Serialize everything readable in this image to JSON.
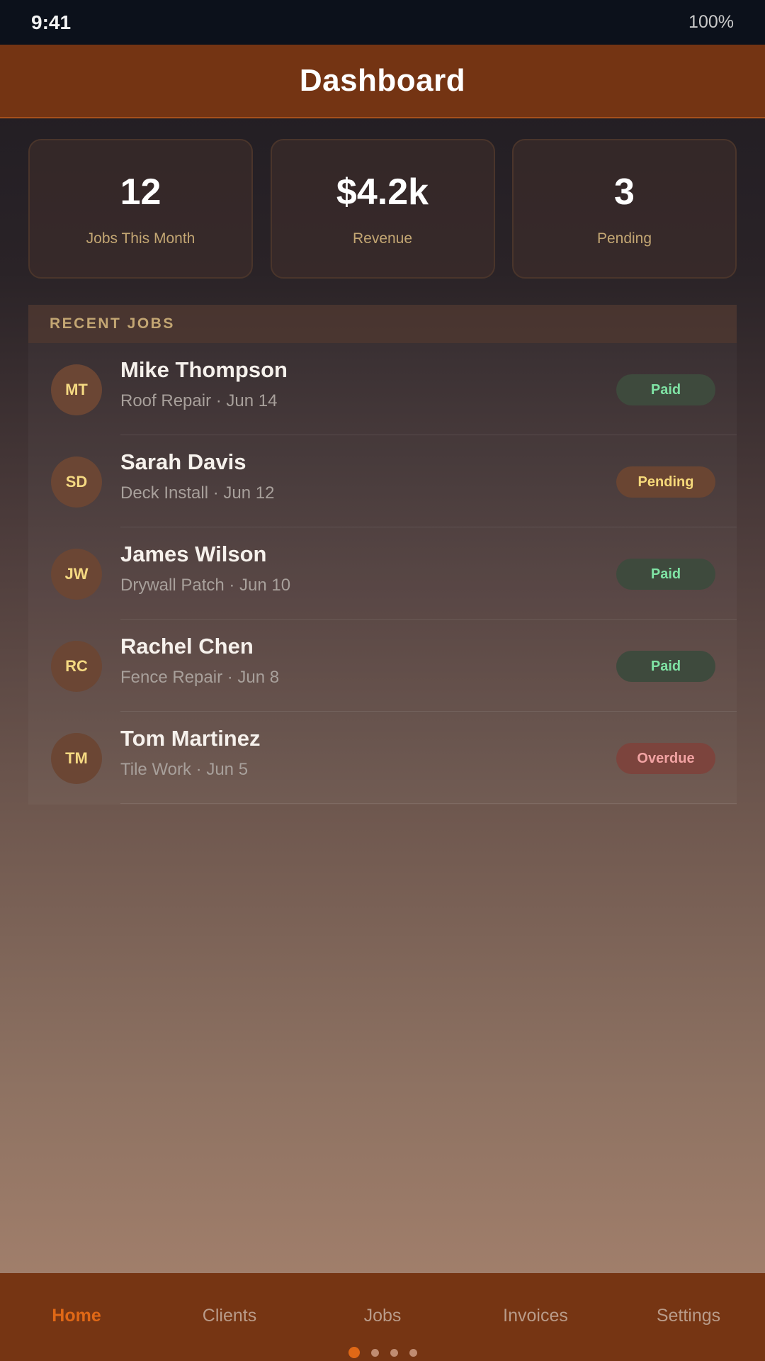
{
  "status": {
    "time": "9:41",
    "battery": "100%"
  },
  "header": {
    "title": "Dashboard"
  },
  "stats": [
    {
      "value": "12",
      "label": "Jobs This Month"
    },
    {
      "value": "$4.2k",
      "label": "Revenue"
    },
    {
      "value": "3",
      "label": "Pending"
    }
  ],
  "recent_jobs": {
    "heading": "RECENT JOBS",
    "items": [
      {
        "initials": "MT",
        "name": "Mike Thompson",
        "detail": "Roof Repair · Jun 14",
        "status": "Paid"
      },
      {
        "initials": "SD",
        "name": "Sarah Davis",
        "detail": "Deck Install · Jun 12",
        "status": "Pending"
      },
      {
        "initials": "JW",
        "name": "James Wilson",
        "detail": "Drywall Patch · Jun 10",
        "status": "Paid"
      },
      {
        "initials": "RC",
        "name": "Rachel Chen",
        "detail": "Fence Repair · Jun 8",
        "status": "Paid"
      },
      {
        "initials": "TM",
        "name": "Tom Martinez",
        "detail": "Tile Work · Jun 5",
        "status": "Overdue"
      }
    ]
  },
  "tabs": [
    {
      "label": "Home",
      "active": true
    },
    {
      "label": "Clients"
    },
    {
      "label": "Jobs"
    },
    {
      "label": "Invoices"
    },
    {
      "label": "Settings"
    }
  ],
  "page_indicator": {
    "count": 4,
    "active": 0
  },
  "colors": {
    "header_bg": "#743413",
    "accent": "#e06816",
    "paid": "#7fe3a4",
    "pending": "#f6d97a",
    "overdue": "#f2a3a3"
  }
}
